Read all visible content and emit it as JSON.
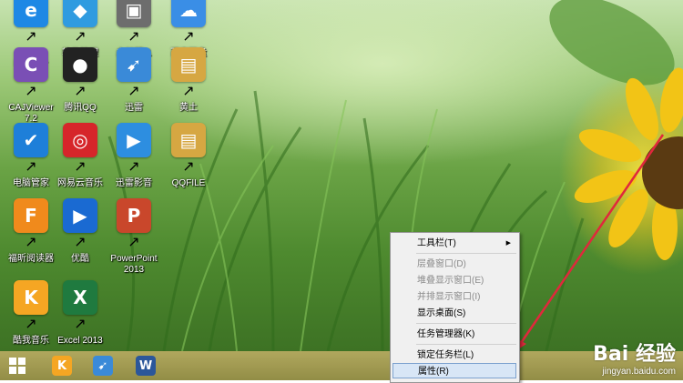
{
  "desktop_icons": [
    {
      "label": "Internet\nExplorer",
      "color": "#1e88e5",
      "glyph": "e"
    },
    {
      "label": "软件管理",
      "color": "#2f9be0",
      "glyph": "◆"
    },
    {
      "label": "未标题-1",
      "color": "#6d6d6d",
      "glyph": "▣"
    },
    {
      "label": "百度网盘",
      "color": "#3a8ee6",
      "glyph": "☁"
    },
    {
      "label": "CAJViewer\n7.2",
      "color": "#7a4fb5",
      "glyph": "C"
    },
    {
      "label": "腾讯QQ",
      "color": "#222222",
      "glyph": "●"
    },
    {
      "label": "迅雷",
      "color": "#3a8ad8",
      "glyph": "➹"
    },
    {
      "label": "黄土",
      "color": "#d6a742",
      "glyph": "▤"
    },
    {
      "label": "电脑管家",
      "color": "#1e7fd9",
      "glyph": "✔"
    },
    {
      "label": "网易云音乐",
      "color": "#d6252a",
      "glyph": "◎"
    },
    {
      "label": "迅雷影音",
      "color": "#2d8ee0",
      "glyph": "▶"
    },
    {
      "label": "QQFILE",
      "color": "#d6a742",
      "glyph": "▤"
    },
    {
      "label": "福昕阅读器",
      "color": "#f08a1c",
      "glyph": "F"
    },
    {
      "label": "优酷",
      "color": "#1a6ad2",
      "glyph": "▶"
    },
    {
      "label": "PowerPoint\n2013",
      "color": "#c9472b",
      "glyph": "P"
    },
    {
      "label": "酷我音乐",
      "color": "#f5a623",
      "glyph": "K"
    },
    {
      "label": "Excel 2013",
      "color": "#1f7a3f",
      "glyph": "X"
    }
  ],
  "taskbar": {
    "start_icon": "windows-logo-icon",
    "pinned": [
      {
        "name": "kuwo-music-icon",
        "color": "#f5a623",
        "glyph": "K"
      },
      {
        "name": "xunlei-icon",
        "color": "#3a8ad8",
        "glyph": "➹"
      },
      {
        "name": "word-icon",
        "color": "#2b579a",
        "glyph": "W"
      }
    ]
  },
  "context_menu": {
    "items": [
      {
        "label": "工具栏(T)",
        "state": "normal",
        "submenu": true
      },
      {
        "label": "层叠窗口(D)",
        "state": "disabled"
      },
      {
        "label": "堆叠显示窗口(E)",
        "state": "disabled"
      },
      {
        "label": "并排显示窗口(I)",
        "state": "disabled"
      },
      {
        "label": "显示桌面(S)",
        "state": "normal"
      },
      {
        "label": "任务管理器(K)",
        "state": "normal"
      },
      {
        "label": "锁定任务栏(L)",
        "state": "normal"
      },
      {
        "label": "属性(R)",
        "state": "highlighted"
      }
    ]
  },
  "watermark": {
    "brand": "Bai 经验",
    "url": "jingyan.baidu.com"
  },
  "annotation_arrow_color": "#e0283c"
}
